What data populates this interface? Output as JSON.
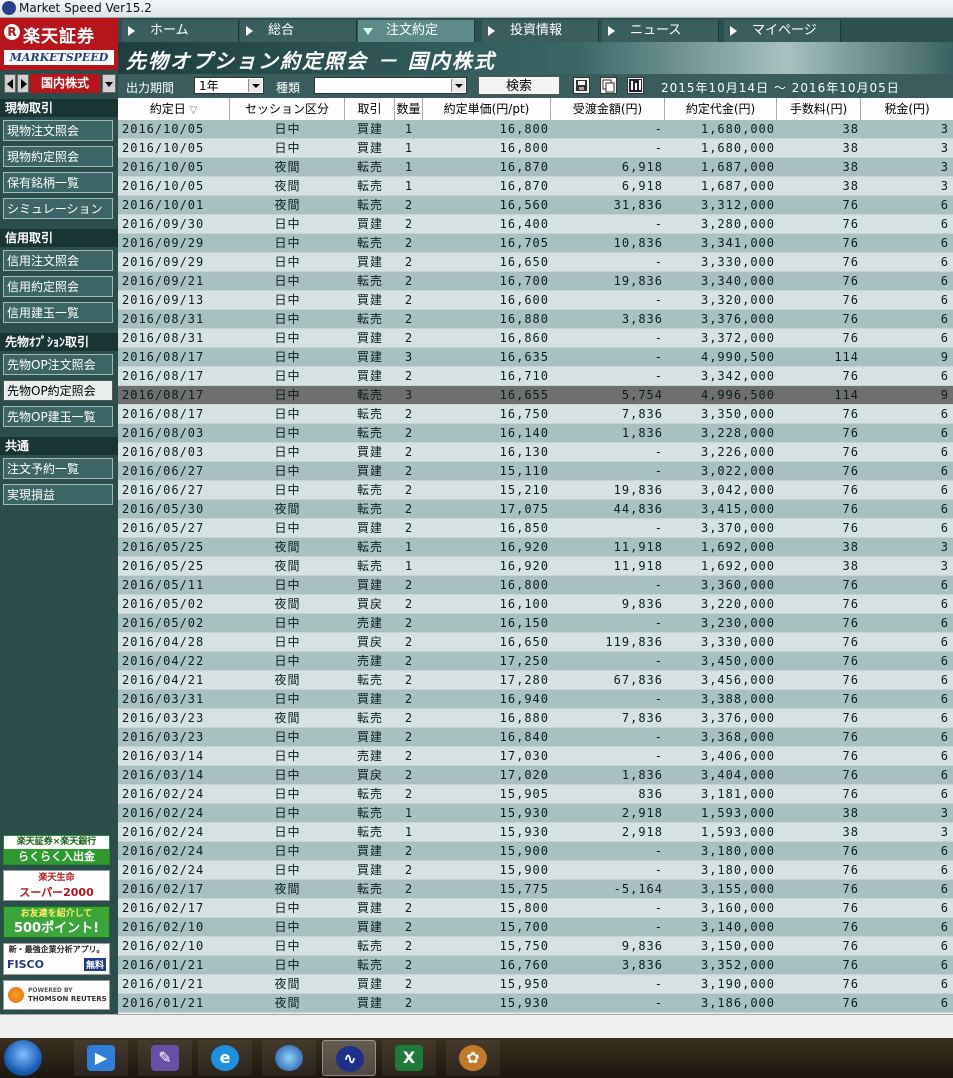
{
  "window": {
    "title": "Market Speed Ver15.2"
  },
  "brand": {
    "name": "楽天証券",
    "sub": "MARKETSPEED",
    "mark": "R"
  },
  "tabs": [
    {
      "label": "ホーム",
      "active": false
    },
    {
      "label": "総合",
      "active": false
    },
    {
      "label": "注文約定",
      "active": true
    },
    {
      "label": "投資情報",
      "active": false
    },
    {
      "label": "ニュース",
      "active": false
    },
    {
      "label": "マイページ",
      "active": false
    }
  ],
  "page": {
    "title": "先物オプション約定照会 － 国内株式"
  },
  "filters": {
    "period_label": "出力期間",
    "period_value": "1年",
    "type_label": "種類",
    "type_value": "",
    "search_label": "検索",
    "period_text": "2015年10月14日 ～ 2016年10月05日"
  },
  "sidebar": {
    "market": "国内株式",
    "sections": [
      {
        "title": "現物取引",
        "items": [
          "現物注文照会",
          "現物約定照会",
          "保有銘柄一覧",
          "シミュレーション"
        ]
      },
      {
        "title": "信用取引",
        "items": [
          "信用注文照会",
          "信用約定照会",
          "信用建玉一覧"
        ]
      },
      {
        "title": "先物ｵﾌﾟｼｮﾝ取引",
        "items": [
          "先物OP注文照会",
          "先物OP約定照会",
          "先物OP建玉一覧"
        ]
      },
      {
        "title": "共通",
        "items": [
          "注文予約一覧",
          "実現損益"
        ]
      }
    ],
    "active_item": "先物OP約定照会",
    "ads": [
      {
        "line1": "楽天証券×楽天銀行",
        "line2": "らくらく入出金"
      },
      {
        "line1": "楽天生命",
        "line2": "スーパー2000"
      },
      {
        "line1": "お友達を紹介して",
        "line2": "500ポイント!"
      },
      {
        "line1": "新・最強企業分析アプリ。",
        "line2": "FISCO",
        "line3": "無料"
      },
      {
        "line1": "POWERED BY",
        "line2": "THOMSON REUTERS"
      }
    ]
  },
  "table": {
    "headers": [
      "約定日",
      "セッション区分",
      "取引",
      "数量",
      "約定単価(円/pt)",
      "受渡金額(円)",
      "約定代金(円)",
      "手数料(円)",
      "税金(円)"
    ],
    "selected_row": 15,
    "rows": [
      [
        "2016/10/05",
        "日中",
        "買建",
        "1",
        "16,800",
        "-",
        "1,680,000",
        "38",
        "3"
      ],
      [
        "2016/10/05",
        "日中",
        "買建",
        "1",
        "16,800",
        "-",
        "1,680,000",
        "38",
        "3"
      ],
      [
        "2016/10/05",
        "夜間",
        "転売",
        "1",
        "16,870",
        "6,918",
        "1,687,000",
        "38",
        "3"
      ],
      [
        "2016/10/05",
        "夜間",
        "転売",
        "1",
        "16,870",
        "6,918",
        "1,687,000",
        "38",
        "3"
      ],
      [
        "2016/10/01",
        "夜間",
        "転売",
        "2",
        "16,560",
        "31,836",
        "3,312,000",
        "76",
        "6"
      ],
      [
        "2016/09/30",
        "日中",
        "買建",
        "2",
        "16,400",
        "-",
        "3,280,000",
        "76",
        "6"
      ],
      [
        "2016/09/29",
        "日中",
        "転売",
        "2",
        "16,705",
        "10,836",
        "3,341,000",
        "76",
        "6"
      ],
      [
        "2016/09/29",
        "日中",
        "買建",
        "2",
        "16,650",
        "-",
        "3,330,000",
        "76",
        "6"
      ],
      [
        "2016/09/21",
        "日中",
        "転売",
        "2",
        "16,700",
        "19,836",
        "3,340,000",
        "76",
        "6"
      ],
      [
        "2016/09/13",
        "日中",
        "買建",
        "2",
        "16,600",
        "-",
        "3,320,000",
        "76",
        "6"
      ],
      [
        "2016/08/31",
        "日中",
        "転売",
        "2",
        "16,880",
        "3,836",
        "3,376,000",
        "76",
        "6"
      ],
      [
        "2016/08/31",
        "日中",
        "買建",
        "2",
        "16,860",
        "-",
        "3,372,000",
        "76",
        "6"
      ],
      [
        "2016/08/17",
        "日中",
        "買建",
        "3",
        "16,635",
        "-",
        "4,990,500",
        "114",
        "9"
      ],
      [
        "2016/08/17",
        "日中",
        "買建",
        "2",
        "16,710",
        "-",
        "3,342,000",
        "76",
        "6"
      ],
      [
        "2016/08/17",
        "日中",
        "転売",
        "3",
        "16,655",
        "5,754",
        "4,996,500",
        "114",
        "9"
      ],
      [
        "2016/08/17",
        "日中",
        "転売",
        "2",
        "16,750",
        "7,836",
        "3,350,000",
        "76",
        "6"
      ],
      [
        "2016/08/03",
        "日中",
        "転売",
        "2",
        "16,140",
        "1,836",
        "3,228,000",
        "76",
        "6"
      ],
      [
        "2016/08/03",
        "日中",
        "買建",
        "2",
        "16,130",
        "-",
        "3,226,000",
        "76",
        "6"
      ],
      [
        "2016/06/27",
        "日中",
        "買建",
        "2",
        "15,110",
        "-",
        "3,022,000",
        "76",
        "6"
      ],
      [
        "2016/06/27",
        "日中",
        "転売",
        "2",
        "15,210",
        "19,836",
        "3,042,000",
        "76",
        "6"
      ],
      [
        "2016/05/30",
        "夜間",
        "転売",
        "2",
        "17,075",
        "44,836",
        "3,415,000",
        "76",
        "6"
      ],
      [
        "2016/05/27",
        "日中",
        "買建",
        "2",
        "16,850",
        "-",
        "3,370,000",
        "76",
        "6"
      ],
      [
        "2016/05/25",
        "夜間",
        "転売",
        "1",
        "16,920",
        "11,918",
        "1,692,000",
        "38",
        "3"
      ],
      [
        "2016/05/25",
        "夜間",
        "転売",
        "1",
        "16,920",
        "11,918",
        "1,692,000",
        "38",
        "3"
      ],
      [
        "2016/05/11",
        "日中",
        "買建",
        "2",
        "16,800",
        "-",
        "3,360,000",
        "76",
        "6"
      ],
      [
        "2016/05/02",
        "夜間",
        "買戻",
        "2",
        "16,100",
        "9,836",
        "3,220,000",
        "76",
        "6"
      ],
      [
        "2016/05/02",
        "日中",
        "売建",
        "2",
        "16,150",
        "-",
        "3,230,000",
        "76",
        "6"
      ],
      [
        "2016/04/28",
        "日中",
        "買戻",
        "2",
        "16,650",
        "119,836",
        "3,330,000",
        "76",
        "6"
      ],
      [
        "2016/04/22",
        "日中",
        "売建",
        "2",
        "17,250",
        "-",
        "3,450,000",
        "76",
        "6"
      ],
      [
        "2016/04/21",
        "夜間",
        "転売",
        "2",
        "17,280",
        "67,836",
        "3,456,000",
        "76",
        "6"
      ],
      [
        "2016/03/31",
        "日中",
        "買建",
        "2",
        "16,940",
        "-",
        "3,388,000",
        "76",
        "6"
      ],
      [
        "2016/03/23",
        "夜間",
        "転売",
        "2",
        "16,880",
        "7,836",
        "3,376,000",
        "76",
        "6"
      ],
      [
        "2016/03/23",
        "日中",
        "買建",
        "2",
        "16,840",
        "-",
        "3,368,000",
        "76",
        "6"
      ],
      [
        "2016/03/14",
        "日中",
        "売建",
        "2",
        "17,030",
        "-",
        "3,406,000",
        "76",
        "6"
      ],
      [
        "2016/03/14",
        "日中",
        "買戻",
        "2",
        "17,020",
        "1,836",
        "3,404,000",
        "76",
        "6"
      ],
      [
        "2016/02/24",
        "日中",
        "転売",
        "2",
        "15,905",
        "836",
        "3,181,000",
        "76",
        "6"
      ],
      [
        "2016/02/24",
        "日中",
        "転売",
        "1",
        "15,930",
        "2,918",
        "1,593,000",
        "38",
        "3"
      ],
      [
        "2016/02/24",
        "日中",
        "転売",
        "1",
        "15,930",
        "2,918",
        "1,593,000",
        "38",
        "3"
      ],
      [
        "2016/02/24",
        "日中",
        "買建",
        "2",
        "15,900",
        "-",
        "3,180,000",
        "76",
        "6"
      ],
      [
        "2016/02/24",
        "日中",
        "買建",
        "2",
        "15,900",
        "-",
        "3,180,000",
        "76",
        "6"
      ],
      [
        "2016/02/17",
        "夜間",
        "転売",
        "2",
        "15,775",
        "-5,164",
        "3,155,000",
        "76",
        "6"
      ],
      [
        "2016/02/17",
        "日中",
        "買建",
        "2",
        "15,800",
        "-",
        "3,160,000",
        "76",
        "6"
      ],
      [
        "2016/02/10",
        "日中",
        "買建",
        "2",
        "15,700",
        "-",
        "3,140,000",
        "76",
        "6"
      ],
      [
        "2016/02/10",
        "日中",
        "転売",
        "2",
        "15,750",
        "9,836",
        "3,150,000",
        "76",
        "6"
      ],
      [
        "2016/01/21",
        "日中",
        "転売",
        "2",
        "16,760",
        "3,836",
        "3,352,000",
        "76",
        "6"
      ],
      [
        "2016/01/21",
        "夜間",
        "買建",
        "2",
        "15,950",
        "-",
        "3,190,000",
        "76",
        "6"
      ],
      [
        "2016/01/21",
        "夜間",
        "買建",
        "2",
        "15,930",
        "-",
        "3,186,000",
        "76",
        "6"
      ]
    ]
  },
  "taskbar": {
    "apps": [
      "windows-start",
      "media-player",
      "paint-app",
      "internet-explorer",
      "google-earth",
      "market-speed",
      "excel",
      "photo-viewer"
    ]
  }
}
